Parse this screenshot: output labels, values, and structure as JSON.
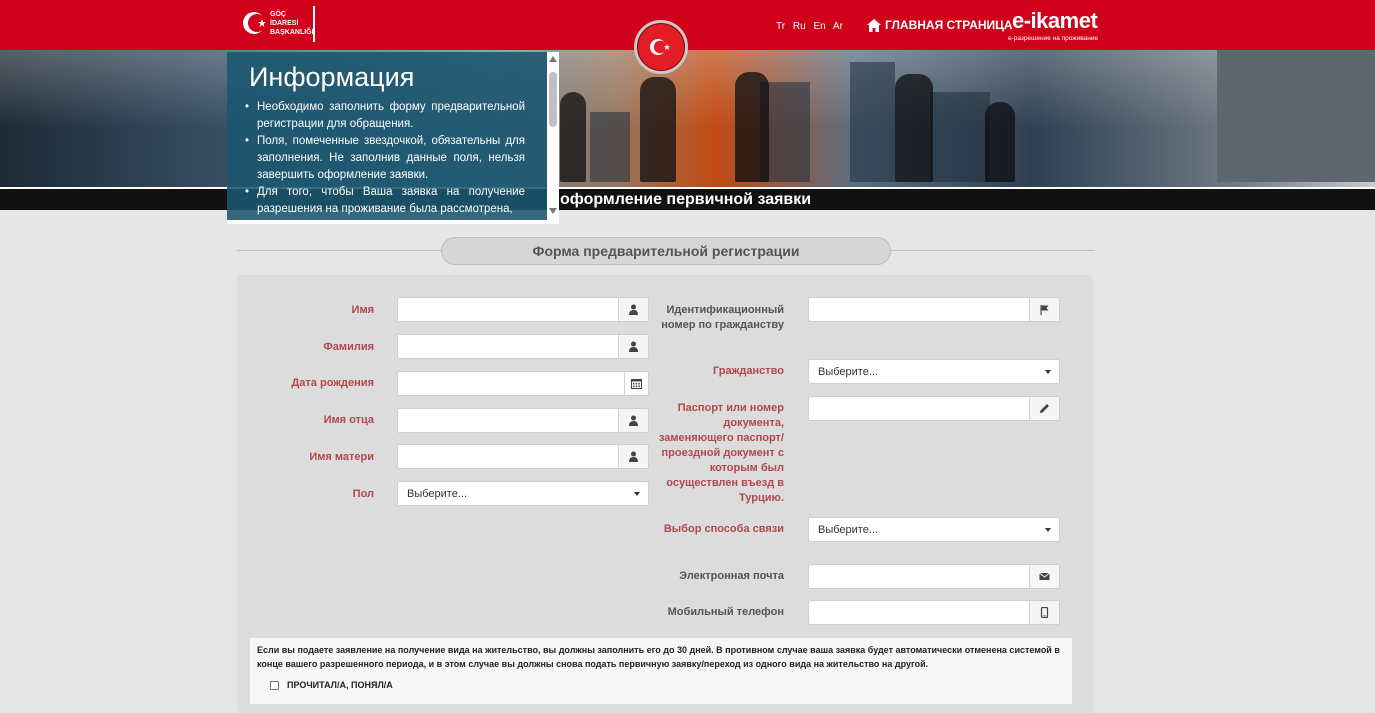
{
  "header": {
    "logo_text": "GÖÇ İDARESİ BAŞKANLIĞI",
    "languages": [
      "Tr",
      "Ru",
      "En",
      "Ar"
    ],
    "home_label": "ГЛАВНАЯ СТРАНИЦА",
    "ikamet_logo": "e-ikamet",
    "ikamet_sub": "e-разрешение на проживание",
    "brand_color": "#d0021b"
  },
  "banner": {
    "title": "оформление первичной заявки"
  },
  "info": {
    "title": "Информация",
    "items": [
      "Необходимо заполнить форму предварительной регистрации для обращения.",
      "Поля, помеченные звездочкой, обязательны для заполнения. Не заполнив данные поля, нельзя завершить оформление заявки.",
      "Для того, чтобы Ваша заявка на получение разрешения на проживание была рассмотрена,"
    ]
  },
  "section": {
    "title": "Форма предварительной регистрации"
  },
  "form": {
    "left": {
      "first_name": "Имя",
      "last_name": "Фамилия",
      "birth_date": "Дата рождения",
      "father_name": "Имя отца",
      "mother_name": "Имя матери",
      "gender": "Пол",
      "gender_value": "Выберите..."
    },
    "right": {
      "national_id": "Идентификационный номер по гражданству",
      "citizenship": "Гражданство",
      "citizenship_value": "Выберите...",
      "passport": "Паспорт или номер документа, заменяющего паспорт/ проездной документ с которым был осуществлен въезд в Турцию.",
      "contact_method": "Выбор способа связи",
      "contact_method_value": "Выберите...",
      "email": "Электронная почта",
      "phone": "Мобильный телефон"
    }
  },
  "notice": {
    "text": "Если вы подаете заявление на получение вида на жительство, вы должны заполнить его до 30 дней. В противном случае ваша заявка будет автоматически отменена системой в конце вашего разрешенного периода, и в этом случае вы должны снова подать первичную заявку/переход из одного вида на жительство на другой.",
    "checkbox_label": "ПРОЧИТАЛ/А, ПОНЯЛ/А"
  },
  "icons": {
    "user": "user-icon",
    "calendar": "calendar-icon",
    "flag": "flag-icon",
    "pencil": "pencil-icon",
    "envelope": "envelope-icon",
    "phone": "phone-icon",
    "home": "home-icon"
  }
}
